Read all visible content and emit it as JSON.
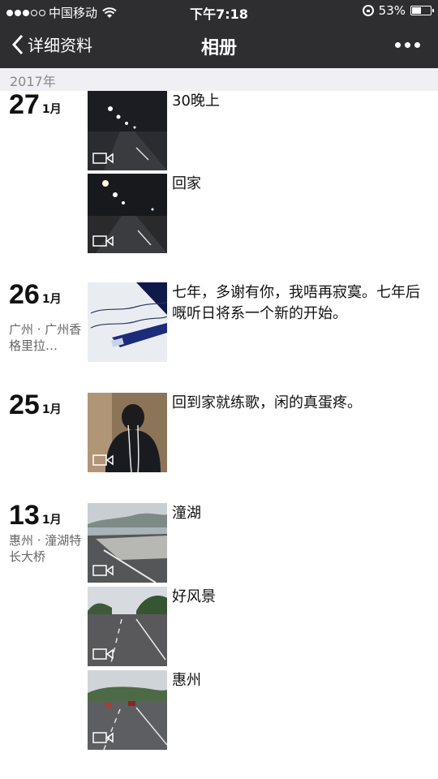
{
  "status": {
    "carrier": "中国移动",
    "time": "下午7:18",
    "battery": "53%",
    "battery_level": 0.53
  },
  "nav": {
    "back_label": "详细资料",
    "title": "相册"
  },
  "year": "2017年",
  "entries": [
    {
      "day": "27",
      "month": "1月",
      "location": "",
      "posts": [
        {
          "caption": "30晚上",
          "thumb": "night-road",
          "video": true
        },
        {
          "caption": "回家",
          "thumb": "night-road",
          "video": true
        }
      ]
    },
    {
      "day": "26",
      "month": "1月",
      "location": "广州 · 广州香格里拉…",
      "posts": [
        {
          "caption": "七年，多谢有你，我唔再寂寞。七年后嘅听日将系一个新的开始。",
          "thumb": "handwriting",
          "video": false
        }
      ]
    },
    {
      "day": "25",
      "month": "1月",
      "location": "",
      "posts": [
        {
          "caption": "回到家就练歌，闲的真蛋疼。",
          "thumb": "selfie",
          "video": true
        }
      ]
    },
    {
      "day": "13",
      "month": "1月",
      "location": "惠州 · 潼湖特长大桥",
      "posts": [
        {
          "caption": "潼湖",
          "thumb": "bridge",
          "video": true
        },
        {
          "caption": "好风景",
          "thumb": "highway",
          "video": true
        },
        {
          "caption": "惠州",
          "thumb": "highway-cars",
          "video": true
        }
      ]
    }
  ]
}
